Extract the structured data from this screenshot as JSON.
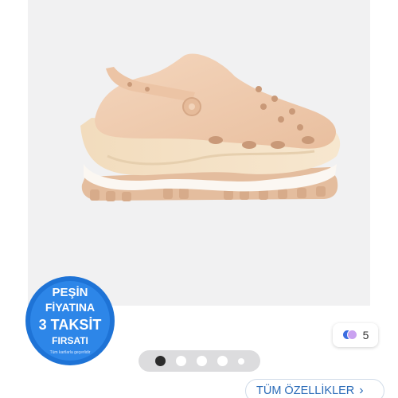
{
  "product": {
    "color_count": "5"
  },
  "promo": {
    "line1": "PEŞİN",
    "line2": "FİYATINA",
    "line3": "3 TAKSİT",
    "line4": "FIRSATI",
    "fineprint": "Tüm kartlarla geçerlidir"
  },
  "carousel": {
    "total": 5,
    "active_index": 0
  },
  "features_button": {
    "label": "TÜM ÖZELLİKLER"
  },
  "icons": {
    "chevron": "chevron-right-icon",
    "swatch": "color-swatch-icon"
  },
  "colors": {
    "link_blue": "#2a6bb8",
    "badge_blue": "#1e73d6",
    "shoe": "#efcdb0"
  }
}
